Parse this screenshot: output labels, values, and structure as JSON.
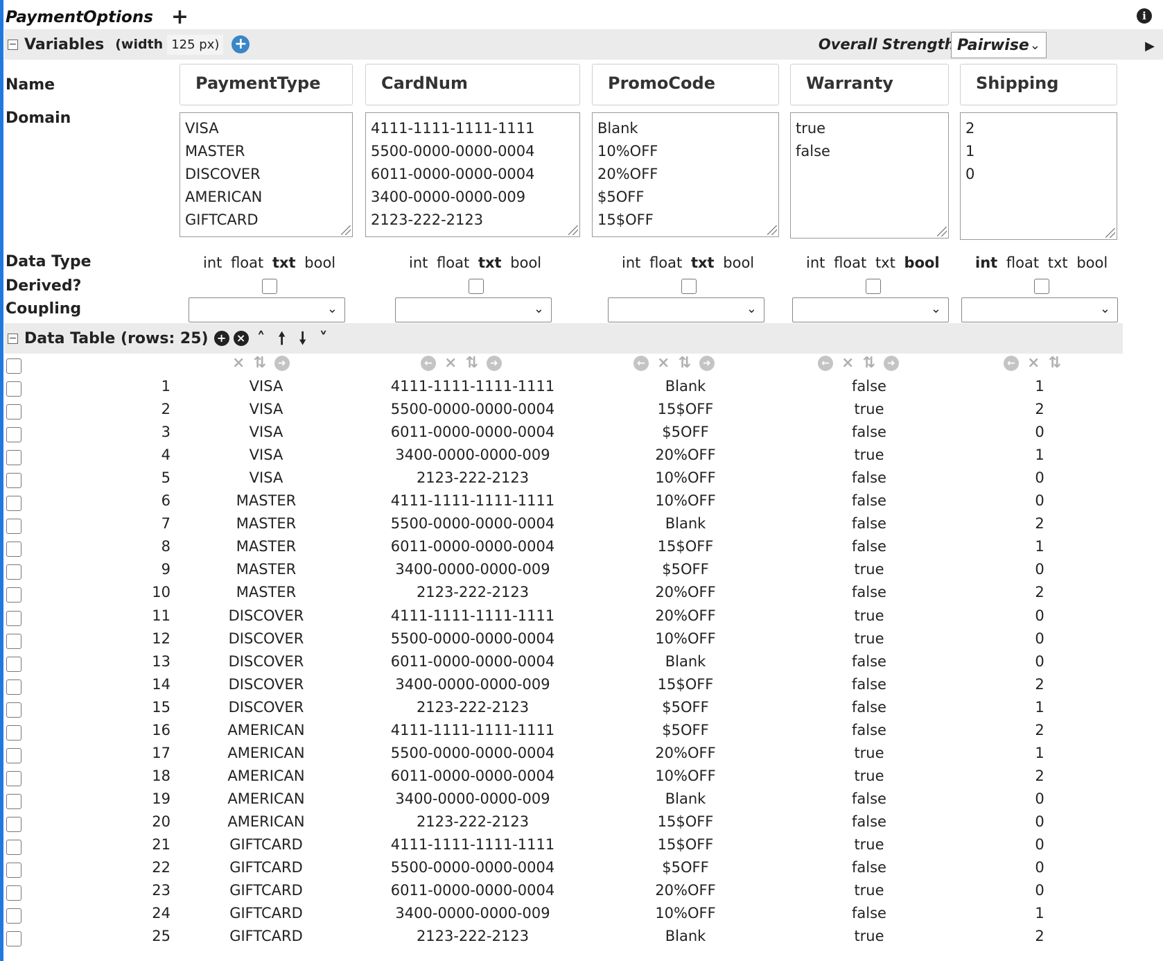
{
  "page": {
    "title": "PaymentOptions"
  },
  "variables_section": {
    "label": "Variables",
    "width_label": "(width",
    "width_value": "125 px)",
    "strength_label": "Overall Strength:",
    "strength_value": "Pairwise"
  },
  "row_labels": {
    "name": "Name",
    "domain": "Domain",
    "data_type": "Data Type",
    "derived": "Derived?",
    "coupling": "Coupling"
  },
  "data_types": [
    "int",
    "float",
    "txt",
    "bool"
  ],
  "variables": [
    {
      "name": "PaymentType",
      "domain": "VISA\nMASTER\nDISCOVER\nAMERICAN\nGIFTCARD",
      "type": "txt"
    },
    {
      "name": "CardNum",
      "domain": "4111-1111-1111-1111\n5500-0000-0000-0004\n6011-0000-0000-0004\n3400-0000-0000-009\n2123-222-2123",
      "type": "txt"
    },
    {
      "name": "PromoCode",
      "domain": "Blank\n10%OFF\n20%OFF\n$5OFF\n15$OFF",
      "type": "txt"
    },
    {
      "name": "Warranty",
      "domain": "true\nfalse",
      "type": "bool"
    },
    {
      "name": "Shipping",
      "domain": "2\n1\n0",
      "type": "int"
    }
  ],
  "data_table": {
    "label": "Data Table (rows: 25)",
    "rows": [
      [
        "1",
        "VISA",
        "4111-1111-1111-1111",
        "Blank",
        "false",
        "1"
      ],
      [
        "2",
        "VISA",
        "5500-0000-0000-0004",
        "15$OFF",
        "true",
        "2"
      ],
      [
        "3",
        "VISA",
        "6011-0000-0000-0004",
        "$5OFF",
        "false",
        "0"
      ],
      [
        "4",
        "VISA",
        "3400-0000-0000-009",
        "20%OFF",
        "true",
        "1"
      ],
      [
        "5",
        "VISA",
        "2123-222-2123",
        "10%OFF",
        "false",
        "0"
      ],
      [
        "6",
        "MASTER",
        "4111-1111-1111-1111",
        "10%OFF",
        "false",
        "0"
      ],
      [
        "7",
        "MASTER",
        "5500-0000-0000-0004",
        "Blank",
        "false",
        "2"
      ],
      [
        "8",
        "MASTER",
        "6011-0000-0000-0004",
        "15$OFF",
        "false",
        "1"
      ],
      [
        "9",
        "MASTER",
        "3400-0000-0000-009",
        "$5OFF",
        "true",
        "0"
      ],
      [
        "10",
        "MASTER",
        "2123-222-2123",
        "20%OFF",
        "false",
        "2"
      ],
      [
        "11",
        "DISCOVER",
        "4111-1111-1111-1111",
        "20%OFF",
        "true",
        "0"
      ],
      [
        "12",
        "DISCOVER",
        "5500-0000-0000-0004",
        "10%OFF",
        "true",
        "0"
      ],
      [
        "13",
        "DISCOVER",
        "6011-0000-0000-0004",
        "Blank",
        "false",
        "0"
      ],
      [
        "14",
        "DISCOVER",
        "3400-0000-0000-009",
        "15$OFF",
        "false",
        "2"
      ],
      [
        "15",
        "DISCOVER",
        "2123-222-2123",
        "$5OFF",
        "false",
        "1"
      ],
      [
        "16",
        "AMERICAN",
        "4111-1111-1111-1111",
        "$5OFF",
        "false",
        "2"
      ],
      [
        "17",
        "AMERICAN",
        "5500-0000-0000-0004",
        "20%OFF",
        "true",
        "1"
      ],
      [
        "18",
        "AMERICAN",
        "6011-0000-0000-0004",
        "10%OFF",
        "true",
        "2"
      ],
      [
        "19",
        "AMERICAN",
        "3400-0000-0000-009",
        "Blank",
        "false",
        "0"
      ],
      [
        "20",
        "AMERICAN",
        "2123-222-2123",
        "15$OFF",
        "false",
        "0"
      ],
      [
        "21",
        "GIFTCARD",
        "4111-1111-1111-1111",
        "15$OFF",
        "true",
        "0"
      ],
      [
        "22",
        "GIFTCARD",
        "5500-0000-0000-0004",
        "$5OFF",
        "false",
        "0"
      ],
      [
        "23",
        "GIFTCARD",
        "6011-0000-0000-0004",
        "20%OFF",
        "true",
        "0"
      ],
      [
        "24",
        "GIFTCARD",
        "3400-0000-0000-009",
        "10%OFF",
        "false",
        "1"
      ],
      [
        "25",
        "GIFTCARD",
        "2123-222-2123",
        "Blank",
        "true",
        "2"
      ]
    ]
  },
  "icons": {
    "add_page": "plus-icon",
    "info": "info-icon",
    "add_variable": "add-circle-icon",
    "collapse": "collapse-icon",
    "add_row": "add-circle-icon",
    "remove_row": "remove-circle-icon",
    "move_top": "chevron-up-icon",
    "move_up": "arrow-up-icon",
    "move_down": "arrow-down-icon",
    "move_bottom": "chevron-down-icon",
    "col_left": "arrow-left-circle-icon",
    "col_delete": "close-icon",
    "col_sort": "sort-icon",
    "col_right": "arrow-right-circle-icon"
  },
  "colors": {
    "accent": "#1f7ae0",
    "add_variable": "#3a86c8",
    "section_bar": "#ebebeb"
  }
}
